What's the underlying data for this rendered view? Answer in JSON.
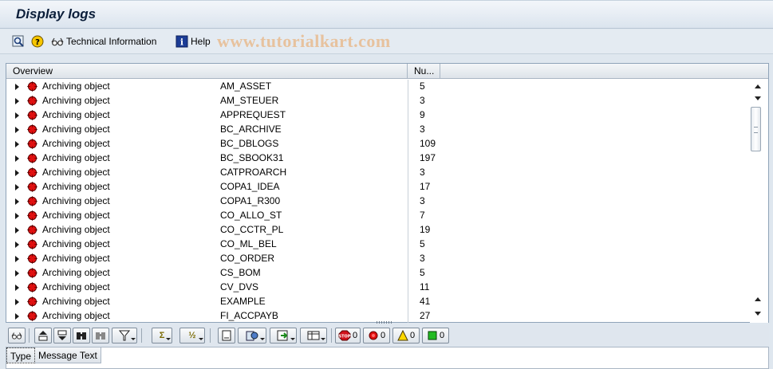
{
  "window": {
    "title": "Display logs"
  },
  "toolbar": {
    "technical_info_label": "Technical Information",
    "help_label": "Help",
    "watermark": "www.tutorialkart.com"
  },
  "tree": {
    "columns": {
      "overview": "Overview",
      "number": "Nu..."
    },
    "rows": [
      {
        "label": "Archiving object",
        "object": "AM_ASSET",
        "count": "5"
      },
      {
        "label": "Archiving object",
        "object": "AM_STEUER",
        "count": "3"
      },
      {
        "label": "Archiving object",
        "object": "APPREQUEST",
        "count": "9"
      },
      {
        "label": "Archiving object",
        "object": "BC_ARCHIVE",
        "count": "3"
      },
      {
        "label": "Archiving object",
        "object": "BC_DBLOGS",
        "count": "109"
      },
      {
        "label": "Archiving object",
        "object": "BC_SBOOK31",
        "count": "197"
      },
      {
        "label": "Archiving object",
        "object": "CATPROARCH",
        "count": "3"
      },
      {
        "label": "Archiving object",
        "object": "COPA1_IDEA",
        "count": "17"
      },
      {
        "label": "Archiving object",
        "object": "COPA1_R300",
        "count": "3"
      },
      {
        "label": "Archiving object",
        "object": "CO_ALLO_ST",
        "count": "7"
      },
      {
        "label": "Archiving object",
        "object": "CO_CCTR_PL",
        "count": "19"
      },
      {
        "label": "Archiving object",
        "object": "CO_ML_BEL",
        "count": "5"
      },
      {
        "label": "Archiving object",
        "object": "CO_ORDER",
        "count": "3"
      },
      {
        "label": "Archiving object",
        "object": "CS_BOM",
        "count": "5"
      },
      {
        "label": "Archiving object",
        "object": "CV_DVS",
        "count": "11"
      },
      {
        "label": "Archiving object",
        "object": "EXAMPLE",
        "count": "41"
      },
      {
        "label": "Archiving object",
        "object": "FI_ACCPAYB",
        "count": "27"
      }
    ]
  },
  "counters": {
    "stop": "0",
    "error": "0",
    "warning": "0",
    "success": "0"
  },
  "messages": {
    "col_type": "Type",
    "col_text": "Message Text"
  },
  "colors": {
    "status_red": "#e01010",
    "warning_yellow": "#ffd800",
    "success_green": "#22bb22",
    "stop_red": "#d0121b"
  }
}
